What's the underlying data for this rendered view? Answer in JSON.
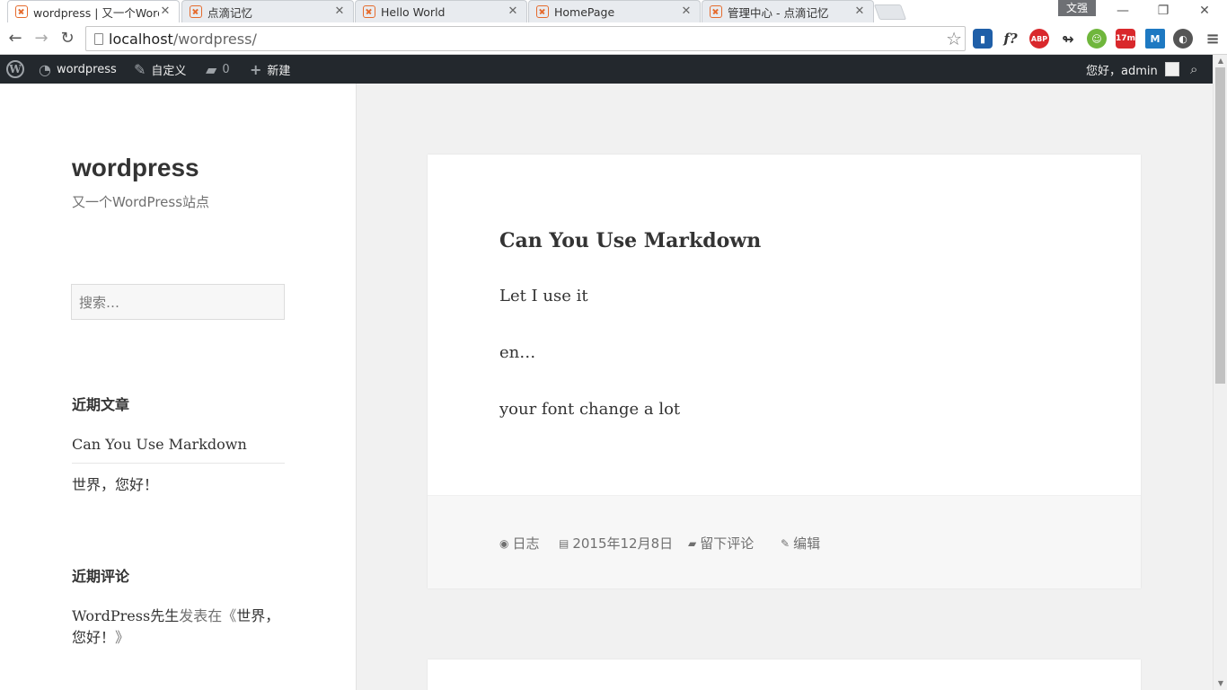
{
  "browser": {
    "tabs": [
      {
        "label": "wordpress | 又一个Word"
      },
      {
        "label": "点滴记忆"
      },
      {
        "label": "Hello World"
      },
      {
        "label": "HomePage"
      },
      {
        "label": "管理中心 - 点滴记忆"
      }
    ],
    "user_badge": "文强",
    "url_host": "localhost",
    "url_path": "/wordpress/",
    "extensions": [
      "f?",
      "ABP",
      "17m",
      "M"
    ]
  },
  "adminbar": {
    "site_name": "wordpress",
    "customize": "自定义",
    "comments_count": "0",
    "new_label": "新建",
    "greeting": "您好，admin"
  },
  "sidebar": {
    "site_title": "wordpress",
    "site_description": "又一个WordPress站点",
    "search_placeholder": "搜索…",
    "recent_posts_title": "近期文章",
    "recent_posts": [
      "Can You Use Markdown",
      "世界，您好！"
    ],
    "recent_comments_title": "近期评论",
    "comment_author": "WordPress先生",
    "comment_connector": "发表在《",
    "comment_post_a": "世界，",
    "comment_post_b": "您好！",
    "comment_close": "》"
  },
  "post": {
    "title": "Can You Use Markdown",
    "paragraphs": [
      "Let I use it",
      "en…",
      "your font change a lot"
    ],
    "meta": {
      "format": "日志",
      "date": "2015年12月8日",
      "comment": "留下评论",
      "edit": "编辑"
    }
  },
  "colors": {
    "adminbar_bg": "#23282d",
    "page_bg": "#f1f1f1",
    "favicon": "#e56b2d"
  }
}
